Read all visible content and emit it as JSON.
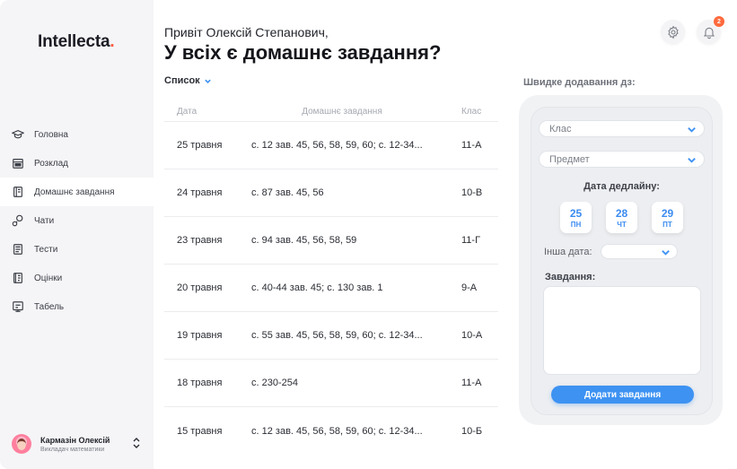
{
  "brand": {
    "name": "Intellecta",
    "dot": "."
  },
  "sidebar": {
    "items": [
      {
        "label": "Головна",
        "icon": "graduation-cap-icon"
      },
      {
        "label": "Розклад",
        "icon": "calendar-icon"
      },
      {
        "label": "Домашнє завдання",
        "icon": "notebook-icon",
        "active": true
      },
      {
        "label": "Чати",
        "icon": "chat-icon"
      },
      {
        "label": "Тести",
        "icon": "test-list-icon"
      },
      {
        "label": "Оцінки",
        "icon": "grades-icon"
      },
      {
        "label": "Табель",
        "icon": "report-card-icon"
      }
    ],
    "user": {
      "name": "Кармазін Олексій",
      "role": "Викладач математики"
    }
  },
  "header": {
    "greeting": "Привіт Олексій Степанович,",
    "headline": "У всіх є домашнє завдання?",
    "notifications_count": "2"
  },
  "list": {
    "view_label": "Список",
    "columns": {
      "date": "Дата",
      "homework": "Домашнє завдання",
      "class": "Клас"
    },
    "rows": [
      {
        "date": "25 травня",
        "homework": "с. 12 зав. 45, 56, 58, 59, 60; с. 12-34...",
        "class": "11-А"
      },
      {
        "date": "24 травня",
        "homework": "с. 87 зав. 45, 56",
        "class": "10-В"
      },
      {
        "date": "23 травня",
        "homework": "с. 94 зав. 45, 56, 58, 59",
        "class": "11-Г"
      },
      {
        "date": "20 травня",
        "homework": "с. 40-44 зав. 45; с. 130 зав. 1",
        "class": "9-А"
      },
      {
        "date": "19 травня",
        "homework": "с. 55 зав. 45, 56, 58, 59, 60; с. 12-34...",
        "class": "10-А"
      },
      {
        "date": "18 травня",
        "homework": "с. 230-254",
        "class": "11-А"
      },
      {
        "date": "15 травня",
        "homework": "с. 12 зав. 45, 56, 58, 59, 60; с. 12-34...",
        "class": "10-Б"
      }
    ]
  },
  "quick_add": {
    "title": "Швидке додавання дз:",
    "class_placeholder": "Клас",
    "subject_placeholder": "Предмет",
    "deadline_label": "Дата дедлайну:",
    "days": [
      {
        "num": "25",
        "dow": "ПН"
      },
      {
        "num": "28",
        "dow": "ЧТ"
      },
      {
        "num": "29",
        "dow": "ПТ"
      }
    ],
    "other_date_label": "Інша дата:",
    "task_label": "Завдання:",
    "submit_label": "Додати завдання"
  },
  "colors": {
    "accent": "#3d92f2",
    "brand_dot": "#ff5a3c",
    "badge": "#ff6a3d"
  }
}
